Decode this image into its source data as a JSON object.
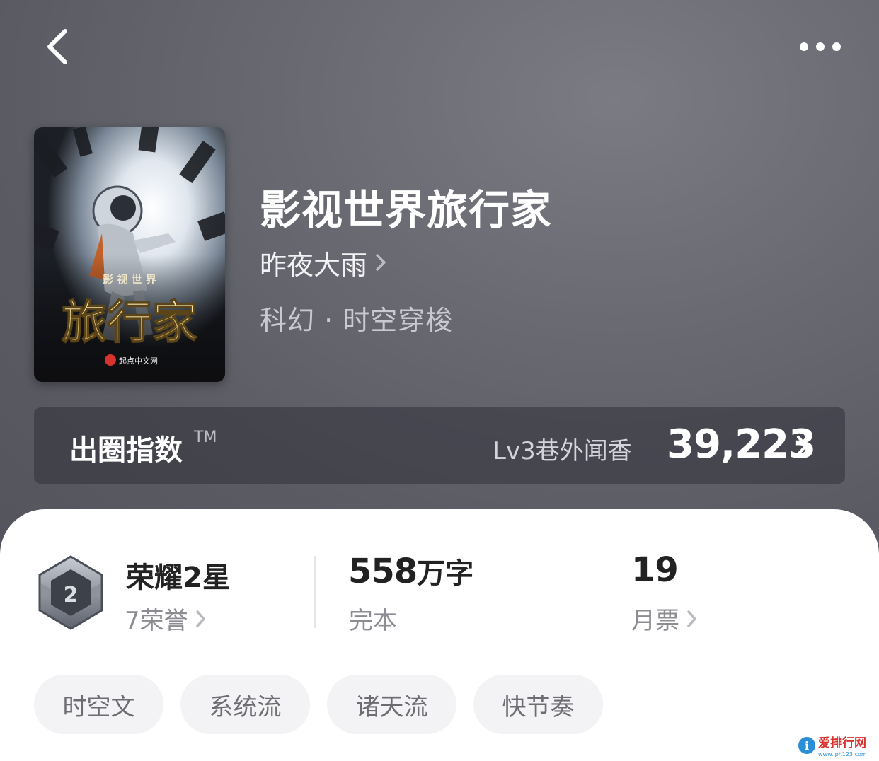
{
  "book": {
    "title": "影视世界旅行家",
    "author": "昨夜大雨",
    "genre": "科幻 · 时空穿梭",
    "cover": {
      "small_text": "影 视 世 界",
      "big_text": "旅行家",
      "brand": "起点中文网"
    }
  },
  "index": {
    "title": "出圈指数",
    "tm": "TM",
    "level": "Lv3巷外闻香",
    "score": "39,223"
  },
  "stats": {
    "honor": {
      "title": "荣耀2星",
      "badge_number": "2",
      "sub": "7荣誉"
    },
    "words": {
      "value": "558",
      "unit": "万字",
      "status": "完本"
    },
    "tickets": {
      "value": "19",
      "label": "月票"
    }
  },
  "tags": [
    "时空文",
    "系统流",
    "诸天流",
    "快节奏"
  ],
  "watermark": {
    "text": "爱排行网",
    "url": "www.iph123.com"
  },
  "icons": {
    "back": "chevron-left-icon",
    "more": "more-dots-icon",
    "chevron": "chevron-right-icon",
    "badge": "honor-badge-icon"
  },
  "colors": {
    "hero_background": "#5f5f68",
    "card_background": "#ffffff",
    "tag_background": "#f3f3f5",
    "cover_gold": "#e8cf8a"
  }
}
